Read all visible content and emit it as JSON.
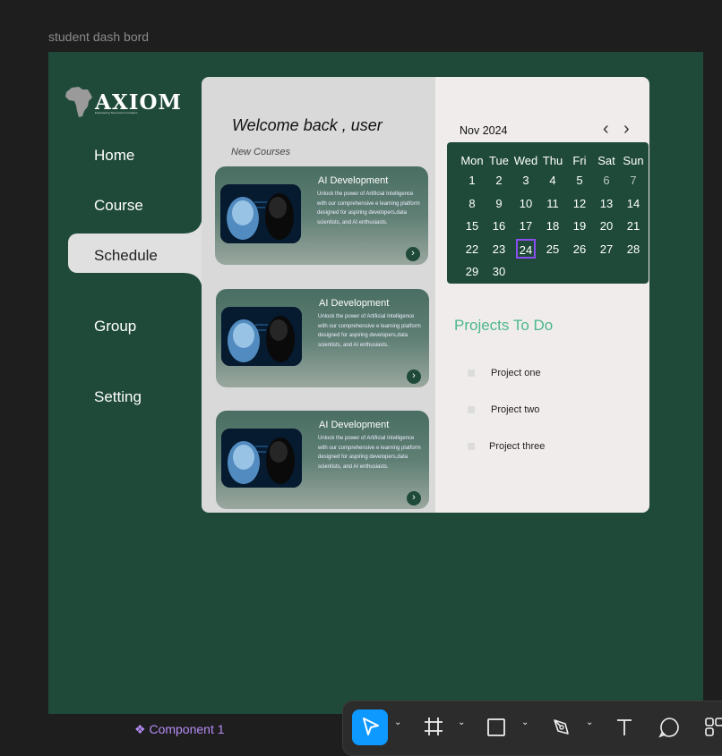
{
  "canvas": {
    "frame_label": "student dash bord",
    "component_label": "Component 1"
  },
  "logo": {
    "name": "AXIOM",
    "tagline": "Empowering Tomorrow's Innovators"
  },
  "nav": {
    "items": [
      {
        "label": "Home"
      },
      {
        "label": "Course"
      },
      {
        "label": "Schedule"
      },
      {
        "label": "Group"
      },
      {
        "label": "Setting"
      }
    ],
    "active": "Schedule"
  },
  "main": {
    "welcome": "Welcome  back , user",
    "new_courses": "New Courses",
    "courses": [
      {
        "title": "AI  Development",
        "description": "Unlock the power of Artificial Intelligence with our comprehensive e learning platform designed for aspiring developers,data scientists, and AI enthusiasts."
      },
      {
        "title": "AI  Development",
        "description": "Unlock the power of Artificial Intelligence with our comprehensive e learning platform designed for aspiring developers,data scientists, and AI enthusiasts."
      },
      {
        "title": "AI  Development",
        "description": "Unlock the power of Artificial Intelligence with our comprehensive e learning platform designed for aspiring developers,data scientists, and AI enthusiasts."
      }
    ]
  },
  "calendar": {
    "month": "Nov 2024",
    "weekdays": [
      "Mon",
      "Tue",
      "Wed",
      "Thu",
      "Fri",
      "Sat",
      "Sun"
    ],
    "weeks": [
      [
        "1",
        "2",
        "3",
        "4",
        "5",
        "6",
        "7"
      ],
      [
        "8",
        "9",
        "10",
        "11",
        "12",
        "13",
        "14"
      ],
      [
        "15",
        "16",
        "17",
        "18",
        "19",
        "20",
        "21"
      ],
      [
        "22",
        "23",
        "24",
        "25",
        "26",
        "27",
        "28"
      ],
      [
        "29",
        "30",
        "",
        "",
        "",
        "",
        ""
      ]
    ],
    "selected": "24",
    "muted": [
      "6",
      "7"
    ]
  },
  "projects": {
    "title": "Projects To Do",
    "items": [
      "Project one",
      "Project two",
      "Project three"
    ]
  },
  "colors": {
    "frame_bg": "#1f4a3a",
    "accent_green": "#4ab88a",
    "selected_outline": "#8a4ff0",
    "toolbar_active": "#0d99ff"
  },
  "toolbar": {
    "tools": [
      "move-tool",
      "frame-tool",
      "rectangle-tool",
      "pen-tool",
      "text-tool",
      "comment-tool",
      "actions-tool"
    ]
  }
}
